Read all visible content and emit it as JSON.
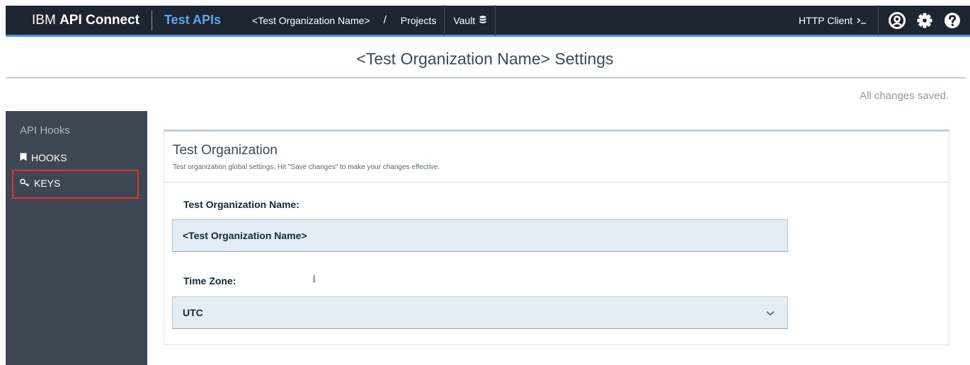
{
  "header": {
    "brand_light": "IBM",
    "brand_bold": "API Connect",
    "product": "Test APIs",
    "breadcrumb_org": "<Test Organization Name>",
    "breadcrumb_sep": "/",
    "breadcrumb_projects": "Projects",
    "vault_label": "Vault",
    "http_client_label": "HTTP Client",
    "icons": [
      "database-icon",
      "terminal-icon",
      "user-icon",
      "gear-icon",
      "help-icon"
    ]
  },
  "page": {
    "title": "<Test Organization Name> Settings",
    "save_status": "All changes saved."
  },
  "sidebar": {
    "heading": "API Hooks",
    "items": [
      {
        "label": "HOOKS",
        "icon": "bookmark-icon"
      },
      {
        "label": "KEYS",
        "icon": "key-icon",
        "highlighted": true
      }
    ]
  },
  "card": {
    "title": "Test Organization",
    "subtitle": "Test organization global settings. Hit \"Save changes\" to make your changes effective.",
    "fields": {
      "org_name_label": "Test Organization Name:",
      "org_name_value": "<Test Organization Name>",
      "timezone_label": "Time Zone:",
      "timezone_value": "UTC"
    }
  },
  "colors": {
    "topbar_bg": "#1d2530",
    "accent_blue": "#5aa7f0",
    "sidebar_bg": "#3d4754",
    "highlight_red": "#e0312b",
    "input_bg": "#e4ecf4"
  }
}
